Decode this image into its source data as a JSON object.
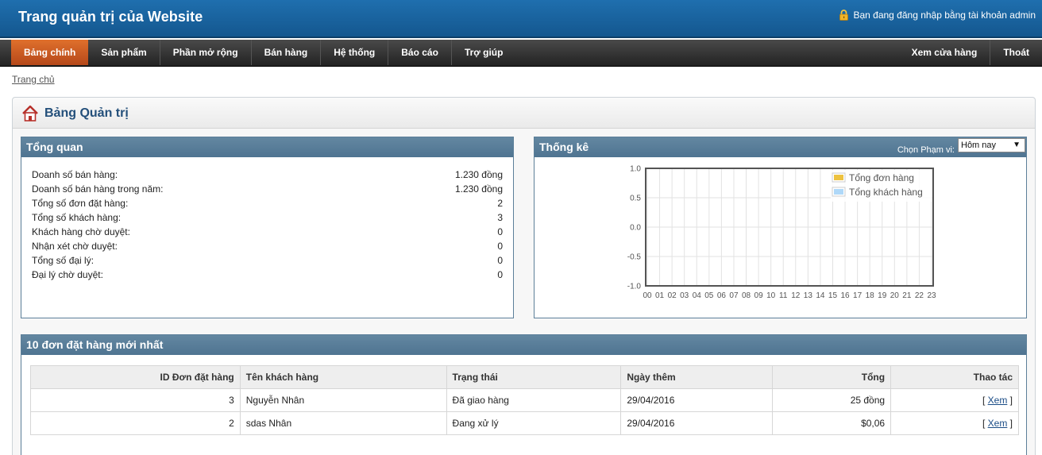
{
  "header": {
    "site_title": "Trang quản trị của Website",
    "login_text": "Bạn đang đăng nhập bằng tài khoản admin"
  },
  "nav": {
    "left": [
      "Bảng chính",
      "Sản phẩm",
      "Phần mở rộng",
      "Bán hàng",
      "Hệ thống",
      "Báo cáo",
      "Trợ giúp"
    ],
    "active": "Bảng chính",
    "right": [
      "Xem cửa hàng",
      "Thoát"
    ]
  },
  "breadcrumb": "Trang chủ",
  "page_title": "Bảng Quản trị",
  "overview": {
    "title": "Tổng quan",
    "rows": [
      {
        "label": "Doanh số bán hàng:",
        "value": "1.230 đồng"
      },
      {
        "label": "Doanh số bán hàng trong năm:",
        "value": "1.230 đồng"
      },
      {
        "label": "Tổng số đơn đặt hàng:",
        "value": "2"
      },
      {
        "label": "Tổng số khách hàng:",
        "value": "3"
      },
      {
        "label": "Khách hàng chờ duyệt:",
        "value": "0"
      },
      {
        "label": "Nhận xét chờ duyệt:",
        "value": "0"
      },
      {
        "label": "Tổng số đại lý:",
        "value": "0"
      },
      {
        "label": "Đại lý chờ duyệt:",
        "value": "0"
      }
    ]
  },
  "stats": {
    "title": "Thống kê",
    "range_label": "Chọn Phạm vi:",
    "range_value": "Hôm nay"
  },
  "chart_data": {
    "type": "line",
    "x": [
      "00",
      "01",
      "02",
      "03",
      "04",
      "05",
      "06",
      "07",
      "08",
      "09",
      "10",
      "11",
      "12",
      "13",
      "14",
      "15",
      "16",
      "17",
      "18",
      "19",
      "20",
      "21",
      "22",
      "23"
    ],
    "series": [
      {
        "name": "Tổng đơn hàng",
        "values": [
          0,
          0,
          0,
          0,
          0,
          0,
          0,
          0,
          0,
          0,
          0,
          0,
          0,
          0,
          0,
          0,
          0,
          0,
          0,
          0,
          0,
          0,
          0,
          0
        ],
        "color": "#edc240"
      },
      {
        "name": "Tổng khách hàng",
        "values": [
          0,
          0,
          0,
          0,
          0,
          0,
          0,
          0,
          0,
          0,
          0,
          0,
          0,
          0,
          0,
          0,
          0,
          0,
          0,
          0,
          0,
          0,
          0,
          0
        ],
        "color": "#afd8f8"
      }
    ],
    "yticks": [
      "1.0",
      "0.5",
      "0.0",
      "-0.5",
      "-1.0"
    ],
    "ylim": [
      -1,
      1
    ],
    "grid": true,
    "legend": "top-right"
  },
  "orders": {
    "title": "10 đơn đặt hàng mới nhất",
    "columns": [
      "ID Đơn đặt hàng",
      "Tên khách hàng",
      "Trạng thái",
      "Ngày thêm",
      "Tổng",
      "Thao tác"
    ],
    "rows": [
      {
        "id": "3",
        "customer": "Nguyễn Nhân",
        "status": "Đã giao hàng",
        "date": "29/04/2016",
        "total": "25 đồng",
        "action_open": "[ ",
        "action": "Xem",
        "action_close": " ]"
      },
      {
        "id": "2",
        "customer": "sdas Nhân",
        "status": "Đang xử lý",
        "date": "29/04/2016",
        "total": "$0,06",
        "action_open": "[ ",
        "action": "Xem",
        "action_close": " ]"
      }
    ]
  }
}
